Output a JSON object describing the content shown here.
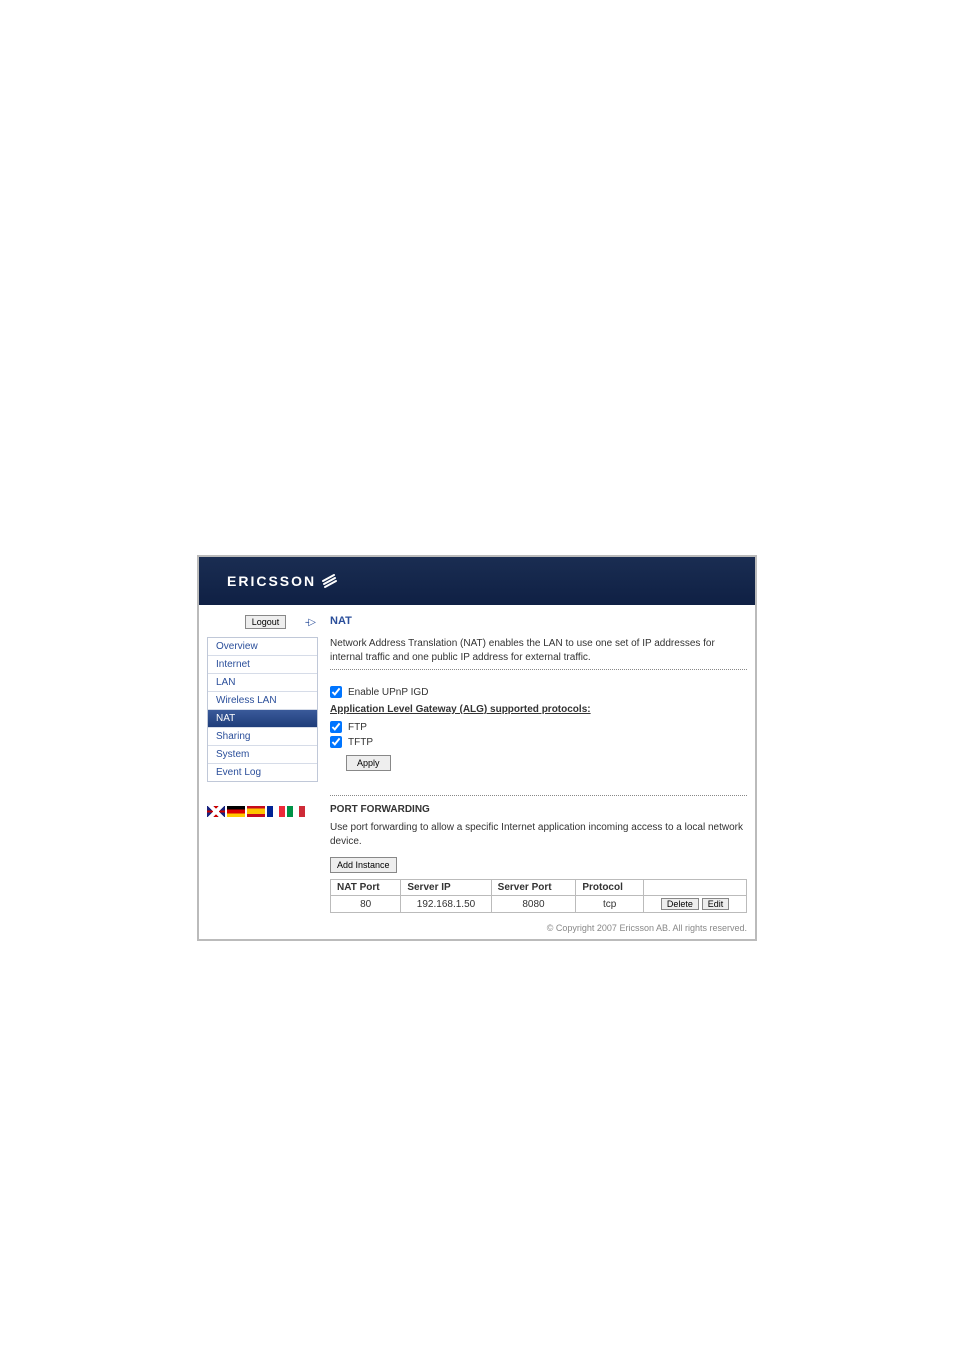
{
  "brand": "ERICSSON",
  "logout_label": "Logout",
  "nav": {
    "items": [
      {
        "label": "Overview"
      },
      {
        "label": "Internet"
      },
      {
        "label": "LAN"
      },
      {
        "label": "Wireless LAN"
      },
      {
        "label": "NAT"
      },
      {
        "label": "Sharing"
      },
      {
        "label": "System"
      },
      {
        "label": "Event Log"
      }
    ],
    "active_index": 4
  },
  "page": {
    "title": "NAT",
    "description": "Network Address Translation (NAT) enables the LAN to use one set of IP addresses for internal traffic and one public IP address for external traffic.",
    "enable_upnp_label": "Enable UPnP IGD",
    "alg_heading": "Application Level Gateway (ALG) supported protocols:",
    "alg": {
      "ftp_label": "FTP",
      "tftp_label": "TFTP"
    },
    "apply_label": "Apply"
  },
  "port_forwarding": {
    "title": "PORT FORWARDING",
    "description": "Use port forwarding to allow a specific Internet application incoming access to a local network device.",
    "add_label": "Add Instance",
    "headers": {
      "nat_port": "NAT Port",
      "server_ip": "Server IP",
      "server_port": "Server Port",
      "protocol": "Protocol"
    },
    "rows": [
      {
        "nat_port": "80",
        "server_ip": "192.168.1.50",
        "server_port": "8080",
        "protocol": "tcp"
      }
    ],
    "delete_label": "Delete",
    "edit_label": "Edit"
  },
  "copyright": "© Copyright 2007 Ericsson AB. All rights reserved."
}
